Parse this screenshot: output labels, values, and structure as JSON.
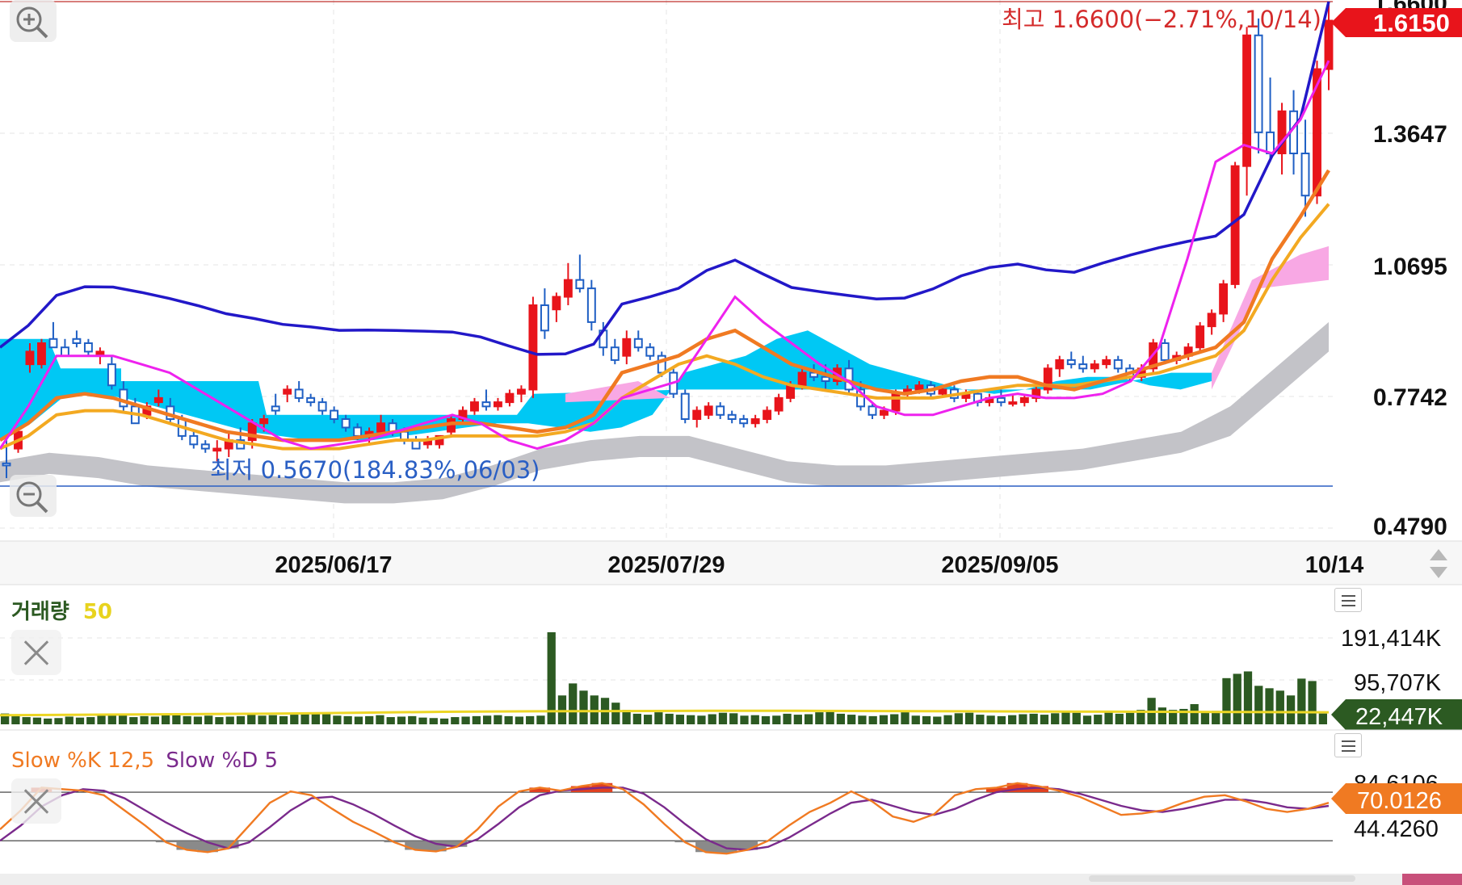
{
  "price_panel": {
    "high_label": "최고 1.6600(−2.71%,10/14)",
    "low_label": "최저 0.5670(184.83%,06/03)",
    "current_price": "1.6150",
    "y_ticks": [
      "1.6600",
      "1.3647",
      "1.0695",
      "0.7742",
      "0.4790"
    ],
    "x_ticks": [
      "2025/06/17",
      "2025/07/29",
      "2025/09/05",
      "10/14"
    ],
    "ylim": [
      0.4,
      1.66
    ],
    "colors": {
      "up": "#e8141b",
      "down": "#1f5fc4",
      "ma5": "#ee22ee",
      "ma20": "#f07a22",
      "ma60": "#f3a921",
      "bollinger": "#2218c8",
      "cloud_cyan": "#00c8f4",
      "cloud_pink": "#f8a8e4",
      "band_gray": "#c3c3c8"
    }
  },
  "volume_panel": {
    "title": "거래량",
    "period": "50",
    "y_ticks": [
      "191,414K",
      "95,707K"
    ],
    "current": "22,447K",
    "ylim": [
      0,
      230000
    ],
    "colors": {
      "bar": "#2c5a22",
      "ma": "#ecd625"
    }
  },
  "stoch_panel": {
    "title_k": "Slow %K 12,5",
    "title_d": "Slow %D 5",
    "y_ticks": [
      "84.6106",
      "44.4260"
    ],
    "current": "70.0126",
    "colors": {
      "k": "#f07a22",
      "d": "#7a2a8c"
    }
  },
  "chart_data": [
    {
      "type": "candlestick",
      "title": "",
      "x_ticks": [
        "2025/06/17",
        "2025/07/29",
        "2025/09/05",
        "10/14"
      ],
      "ylim": [
        0.4,
        1.66
      ],
      "ohlc": [
        [
          0.565,
          0.62,
          0.53,
          0.56
        ],
        [
          0.6,
          0.65,
          0.59,
          0.64
        ],
        [
          0.8,
          0.85,
          0.78,
          0.83
        ],
        [
          0.8,
          0.86,
          0.79,
          0.85
        ],
        [
          0.86,
          0.9,
          0.84,
          0.84
        ],
        [
          0.84,
          0.86,
          0.82,
          0.82
        ],
        [
          0.86,
          0.88,
          0.84,
          0.85
        ],
        [
          0.85,
          0.86,
          0.82,
          0.83
        ],
        [
          0.82,
          0.84,
          0.8,
          0.83
        ],
        [
          0.8,
          0.82,
          0.74,
          0.75
        ],
        [
          0.74,
          0.76,
          0.69,
          0.7
        ],
        [
          0.7,
          0.72,
          0.66,
          0.66
        ],
        [
          0.68,
          0.71,
          0.67,
          0.7
        ],
        [
          0.71,
          0.74,
          0.7,
          0.72
        ],
        [
          0.7,
          0.72,
          0.66,
          0.67
        ],
        [
          0.67,
          0.68,
          0.62,
          0.63
        ],
        [
          0.63,
          0.64,
          0.6,
          0.61
        ],
        [
          0.61,
          0.62,
          0.59,
          0.6
        ],
        [
          0.595,
          0.62,
          0.57,
          0.6
        ],
        [
          0.6,
          0.64,
          0.58,
          0.62
        ],
        [
          0.62,
          0.65,
          0.6,
          0.6
        ],
        [
          0.62,
          0.67,
          0.6,
          0.66
        ],
        [
          0.66,
          0.68,
          0.64,
          0.67
        ],
        [
          0.7,
          0.73,
          0.68,
          0.69
        ],
        [
          0.73,
          0.75,
          0.71,
          0.74
        ],
        [
          0.74,
          0.76,
          0.71,
          0.72
        ],
        [
          0.72,
          0.73,
          0.7,
          0.71
        ],
        [
          0.71,
          0.72,
          0.68,
          0.69
        ],
        [
          0.69,
          0.7,
          0.66,
          0.67
        ],
        [
          0.67,
          0.68,
          0.64,
          0.65
        ],
        [
          0.65,
          0.66,
          0.62,
          0.63
        ],
        [
          0.63,
          0.65,
          0.61,
          0.64
        ],
        [
          0.64,
          0.68,
          0.63,
          0.66
        ],
        [
          0.66,
          0.67,
          0.63,
          0.64
        ],
        [
          0.64,
          0.65,
          0.61,
          0.62
        ],
        [
          0.62,
          0.63,
          0.6,
          0.6
        ],
        [
          0.61,
          0.63,
          0.6,
          0.62
        ],
        [
          0.61,
          0.63,
          0.6,
          0.63
        ],
        [
          0.64,
          0.68,
          0.63,
          0.67
        ],
        [
          0.67,
          0.7,
          0.66,
          0.69
        ],
        [
          0.69,
          0.72,
          0.68,
          0.71
        ],
        [
          0.71,
          0.74,
          0.69,
          0.7
        ],
        [
          0.7,
          0.72,
          0.69,
          0.71
        ],
        [
          0.71,
          0.74,
          0.7,
          0.73
        ],
        [
          0.73,
          0.75,
          0.71,
          0.74
        ],
        [
          0.74,
          0.96,
          0.72,
          0.94
        ],
        [
          0.94,
          0.98,
          0.86,
          0.88
        ],
        [
          0.93,
          0.97,
          0.9,
          0.96
        ],
        [
          0.96,
          1.04,
          0.94,
          1.0
        ],
        [
          1.0,
          1.06,
          0.97,
          0.98
        ],
        [
          0.98,
          1.0,
          0.88,
          0.9
        ],
        [
          0.88,
          0.9,
          0.82,
          0.84
        ],
        [
          0.84,
          0.86,
          0.8,
          0.81
        ],
        [
          0.82,
          0.88,
          0.8,
          0.86
        ],
        [
          0.86,
          0.88,
          0.83,
          0.84
        ],
        [
          0.84,
          0.85,
          0.81,
          0.82
        ],
        [
          0.82,
          0.83,
          0.77,
          0.78
        ],
        [
          0.78,
          0.79,
          0.72,
          0.73
        ],
        [
          0.73,
          0.74,
          0.66,
          0.67
        ],
        [
          0.67,
          0.7,
          0.65,
          0.69
        ],
        [
          0.68,
          0.71,
          0.67,
          0.7
        ],
        [
          0.7,
          0.71,
          0.67,
          0.68
        ],
        [
          0.68,
          0.69,
          0.66,
          0.67
        ],
        [
          0.67,
          0.68,
          0.65,
          0.66
        ],
        [
          0.66,
          0.68,
          0.65,
          0.67
        ],
        [
          0.67,
          0.7,
          0.66,
          0.69
        ],
        [
          0.69,
          0.73,
          0.68,
          0.72
        ],
        [
          0.72,
          0.76,
          0.71,
          0.75
        ],
        [
          0.75,
          0.79,
          0.74,
          0.78
        ],
        [
          0.78,
          0.8,
          0.76,
          0.77
        ],
        [
          0.77,
          0.8,
          0.74,
          0.76
        ],
        [
          0.76,
          0.8,
          0.75,
          0.79
        ],
        [
          0.79,
          0.81,
          0.73,
          0.74
        ],
        [
          0.74,
          0.76,
          0.69,
          0.7
        ],
        [
          0.7,
          0.71,
          0.67,
          0.68
        ],
        [
          0.68,
          0.7,
          0.67,
          0.69
        ],
        [
          0.69,
          0.74,
          0.68,
          0.73
        ],
        [
          0.73,
          0.75,
          0.72,
          0.74
        ],
        [
          0.74,
          0.76,
          0.73,
          0.75
        ],
        [
          0.75,
          0.76,
          0.72,
          0.73
        ],
        [
          0.73,
          0.75,
          0.72,
          0.74
        ],
        [
          0.74,
          0.75,
          0.71,
          0.72
        ],
        [
          0.72,
          0.74,
          0.71,
          0.73
        ],
        [
          0.73,
          0.74,
          0.7,
          0.71
        ],
        [
          0.71,
          0.73,
          0.7,
          0.72
        ],
        [
          0.72,
          0.74,
          0.7,
          0.71
        ],
        [
          0.71,
          0.73,
          0.7,
          0.71
        ],
        [
          0.71,
          0.73,
          0.7,
          0.72
        ],
        [
          0.72,
          0.75,
          0.71,
          0.74
        ],
        [
          0.74,
          0.8,
          0.73,
          0.79
        ],
        [
          0.79,
          0.82,
          0.77,
          0.81
        ],
        [
          0.81,
          0.83,
          0.79,
          0.8
        ],
        [
          0.8,
          0.82,
          0.78,
          0.79
        ],
        [
          0.79,
          0.81,
          0.78,
          0.8
        ],
        [
          0.8,
          0.82,
          0.79,
          0.81
        ],
        [
          0.81,
          0.82,
          0.78,
          0.79
        ],
        [
          0.79,
          0.8,
          0.76,
          0.77
        ],
        [
          0.77,
          0.8,
          0.76,
          0.79
        ],
        [
          0.79,
          0.86,
          0.78,
          0.85
        ],
        [
          0.85,
          0.86,
          0.8,
          0.81
        ],
        [
          0.81,
          0.83,
          0.8,
          0.82
        ],
        [
          0.82,
          0.85,
          0.81,
          0.84
        ],
        [
          0.84,
          0.9,
          0.83,
          0.89
        ],
        [
          0.89,
          0.93,
          0.87,
          0.92
        ],
        [
          0.92,
          1.0,
          0.9,
          0.99
        ],
        [
          0.99,
          1.28,
          0.98,
          1.27
        ],
        [
          1.27,
          1.6,
          1.2,
          1.58
        ],
        [
          1.58,
          1.62,
          1.3,
          1.35
        ],
        [
          1.35,
          1.48,
          1.28,
          1.3
        ],
        [
          1.3,
          1.42,
          1.25,
          1.4
        ],
        [
          1.4,
          1.45,
          1.25,
          1.3
        ],
        [
          1.3,
          1.38,
          1.15,
          1.2
        ],
        [
          1.2,
          1.52,
          1.18,
          1.5
        ],
        [
          1.5,
          1.66,
          1.45,
          1.615
        ]
      ],
      "series": [
        {
          "name": "MA5",
          "values": [
            0.6,
            0.7,
            0.82,
            0.82,
            0.82,
            0.8,
            0.78,
            0.74,
            0.7,
            0.66,
            0.62,
            0.6,
            0.61,
            0.62,
            0.64,
            0.66,
            0.68,
            0.66,
            0.62,
            0.6,
            0.62,
            0.66,
            0.72,
            0.74,
            0.76,
            0.86,
            0.96,
            0.9,
            0.85,
            0.8,
            0.76,
            0.7,
            0.68,
            0.68,
            0.7,
            0.72,
            0.73,
            0.72,
            0.72,
            0.73,
            0.76,
            0.84,
            1.05,
            1.28,
            1.32,
            1.3,
            1.38,
            1.52
          ]
        },
        {
          "name": "MA20",
          "values": [
            0.62,
            0.66,
            0.72,
            0.73,
            0.72,
            0.7,
            0.68,
            0.66,
            0.64,
            0.63,
            0.62,
            0.62,
            0.62,
            0.63,
            0.64,
            0.65,
            0.66,
            0.66,
            0.65,
            0.64,
            0.65,
            0.68,
            0.78,
            0.8,
            0.82,
            0.86,
            0.88,
            0.84,
            0.8,
            0.78,
            0.76,
            0.74,
            0.73,
            0.74,
            0.76,
            0.77,
            0.77,
            0.75,
            0.74,
            0.76,
            0.78,
            0.8,
            0.82,
            0.84,
            0.9,
            1.05,
            1.15,
            1.26
          ]
        },
        {
          "name": "MA60",
          "values": [
            0.6,
            0.63,
            0.68,
            0.69,
            0.69,
            0.68,
            0.66,
            0.64,
            0.62,
            0.61,
            0.6,
            0.6,
            0.6,
            0.61,
            0.62,
            0.62,
            0.63,
            0.63,
            0.63,
            0.63,
            0.64,
            0.66,
            0.72,
            0.76,
            0.8,
            0.82,
            0.8,
            0.77,
            0.75,
            0.74,
            0.73,
            0.72,
            0.72,
            0.72,
            0.73,
            0.74,
            0.75,
            0.75,
            0.75,
            0.76,
            0.77,
            0.78,
            0.8,
            0.82,
            0.88,
            1.0,
            1.1,
            1.18
          ]
        }
      ]
    },
    {
      "type": "bar",
      "title": "거래량 50",
      "y_ticks": [
        "191,414K",
        "95,707K"
      ],
      "ylim": [
        0,
        230000
      ],
      "values": [
        22447,
        18000,
        15000,
        14000,
        12000,
        13000,
        16000,
        14000,
        15000,
        18000,
        20000,
        22000,
        15000,
        17000,
        16000,
        19000,
        21000,
        17000,
        16000,
        18000,
        15000,
        16000,
        17000,
        20000,
        18000,
        19000,
        17000,
        20000,
        22000,
        21000,
        24000,
        18000,
        17000,
        16000,
        17000,
        19000,
        15000,
        16000,
        17000,
        14000,
        13000,
        12000,
        15000,
        16000,
        17000,
        18000,
        19000,
        17000,
        16000,
        17000,
        18000,
        191414,
        60000,
        85000,
        70000,
        60000,
        55000,
        45000,
        30000,
        22000,
        20000,
        25000,
        22000,
        20000,
        19000,
        18000,
        21000,
        24000,
        23000,
        18000,
        19000,
        17000,
        18000,
        22000,
        20000,
        21000,
        25000,
        28000,
        22000,
        20000,
        18000,
        17000,
        19000,
        21000,
        25000,
        18000,
        17000,
        16000,
        19000,
        23000,
        24000,
        20000,
        18000,
        17000,
        19000,
        21000,
        22000,
        20000,
        23000,
        25000,
        24000,
        18000,
        20000,
        26000,
        22000,
        24000,
        30000,
        55000,
        35000,
        30000,
        32000,
        42000,
        26000,
        28000,
        96000,
        105000,
        110000,
        80000,
        75000,
        70000,
        60000,
        95000,
        90000,
        22447
      ],
      "series": [
        {
          "name": "50",
          "values": [
            19000,
            20000,
            21000,
            22000,
            24000,
            26000,
            27000,
            27500,
            28000,
            28000,
            27500,
            27000,
            26500,
            26000,
            25500,
            25000
          ]
        }
      ]
    },
    {
      "type": "line",
      "title": "Slow %K 12,5 Slow %D 5",
      "y_ticks": [
        "84.6106",
        "44.4260"
      ],
      "ylim": [
        0,
        100
      ],
      "series": [
        {
          "name": "Slow %K 12,5",
          "values": [
            35,
            60,
            90,
            88,
            86,
            80,
            60,
            40,
            18,
            8,
            5,
            10,
            40,
            70,
            85,
            80,
            62,
            45,
            32,
            18,
            8,
            6,
            12,
            35,
            65,
            85,
            90,
            86,
            92,
            96,
            88,
            68,
            42,
            18,
            5,
            3,
            8,
            20,
            40,
            58,
            70,
            85,
            72,
            52,
            45,
            55,
            80,
            88,
            90,
            96,
            92,
            86,
            78,
            66,
            54,
            56,
            60,
            70,
            78,
            80,
            72,
            62,
            58,
            62,
            70
          ]
        },
        {
          "name": "Slow %D 5",
          "values": [
            20,
            40,
            65,
            80,
            88,
            86,
            76,
            60,
            44,
            30,
            18,
            10,
            18,
            38,
            60,
            76,
            78,
            68,
            55,
            40,
            26,
            16,
            12,
            22,
            42,
            64,
            80,
            86,
            88,
            90,
            90,
            82,
            64,
            42,
            22,
            10,
            8,
            12,
            24,
            40,
            56,
            70,
            74,
            66,
            58,
            54,
            62,
            74,
            84,
            88,
            90,
            88,
            82,
            74,
            66,
            60,
            58,
            62,
            68,
            74,
            74,
            70,
            64,
            62,
            66
          ]
        }
      ]
    }
  ]
}
